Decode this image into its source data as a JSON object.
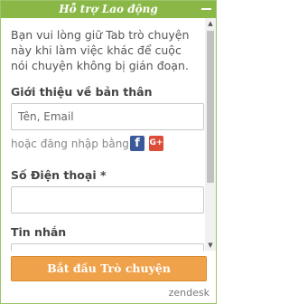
{
  "header": {
    "title": "Hỗ trợ Lao động",
    "minimize_icon": "minimize-icon"
  },
  "form": {
    "intro": "Bạn vui lòng giữ Tab trò chuyện này khi làm việc khác để cuộc nói chuyện không bị gián đoạn.",
    "about_label": "Giới thiệu về bản thân",
    "name_email_placeholder": "Tên, Email",
    "login_prefix": "hoặc đăng nhập bằng",
    "facebook_icon": "facebook-icon",
    "facebook_glyph": "f",
    "google_icon": "google-plus-icon",
    "google_glyph": "G+",
    "phone_label": "Số Điện thoại *",
    "phone_value": "",
    "message_label": "Tin nhắn"
  },
  "footer": {
    "start_button": "Bắt đầu Trò chuyện",
    "brand": "zendesk"
  },
  "colors": {
    "header": "#8ab847",
    "button": "#f0a24b",
    "facebook": "#3b5998",
    "google": "#dd4b39"
  }
}
